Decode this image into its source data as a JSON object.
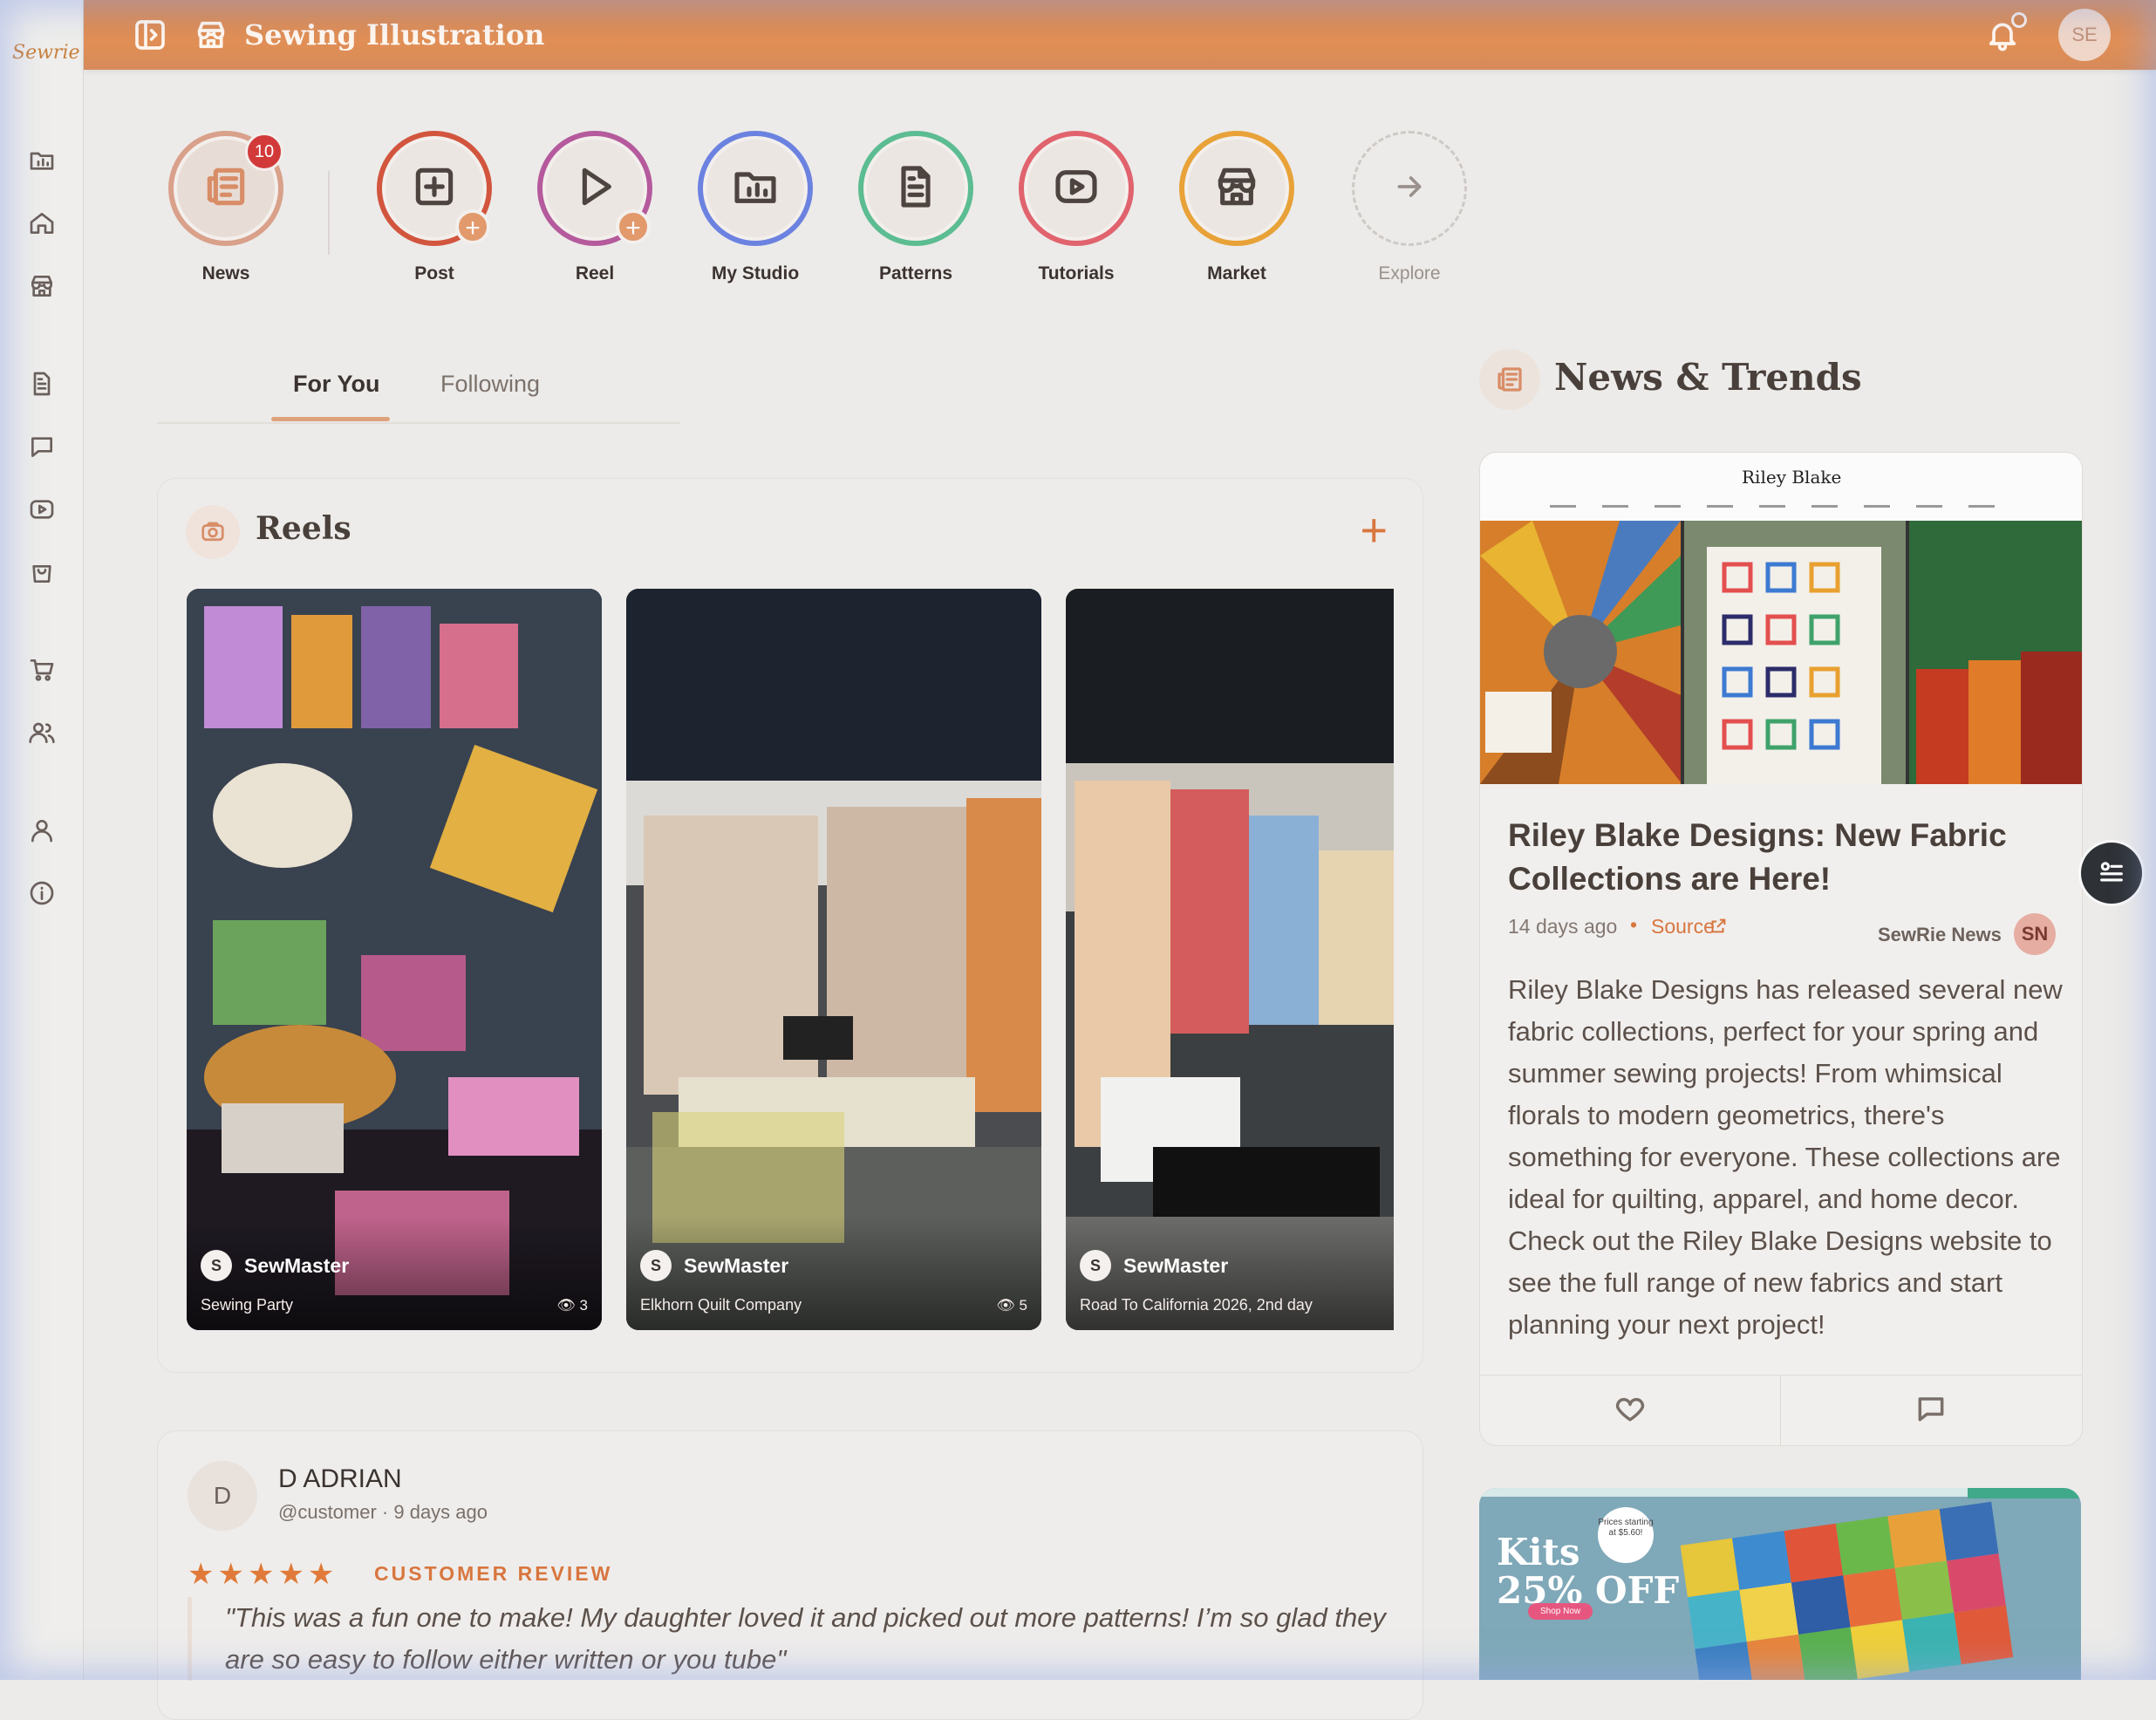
{
  "app": {
    "logo_text": "Sewrie",
    "title": "Sewing Illustration",
    "avatar_initials": "SE"
  },
  "stories": [
    {
      "label": "News",
      "badge": "10",
      "ring": "#d9a08a",
      "icon": "newspaper-icon"
    },
    {
      "label": "Post",
      "ring": "#d2553e",
      "icon": "plus-square-icon"
    },
    {
      "label": "Reel",
      "ring": "#b55a9d",
      "icon": "play-icon"
    },
    {
      "label": "My Studio",
      "ring": "#6c82e0",
      "icon": "folder-chart-icon"
    },
    {
      "label": "Patterns",
      "ring": "#5cbc92",
      "icon": "document-icon"
    },
    {
      "label": "Tutorials",
      "ring": "#e0636e",
      "icon": "video-icon"
    },
    {
      "label": "Market",
      "ring": "#e8a238",
      "icon": "store-icon"
    },
    {
      "label": "Explore",
      "icon": "arrow-right-icon"
    }
  ],
  "tabs": {
    "for_you": "For You",
    "following": "Following"
  },
  "reels": {
    "title": "Reels",
    "items": [
      {
        "avatar": "S",
        "author": "SewMaster",
        "caption": "Sewing Party",
        "views": "3"
      },
      {
        "avatar": "S",
        "author": "SewMaster",
        "caption": "Elkhorn Quilt Company",
        "views": "5"
      },
      {
        "avatar": "S",
        "author": "SewMaster",
        "caption": "Road To California 2026, 2nd day",
        "views": ""
      }
    ]
  },
  "post": {
    "avatar": "D",
    "name": "D ADRIAN",
    "meta": "@customer · 9 days ago",
    "rating": 5,
    "tag": "CUSTOMER REVIEW",
    "quote": "\"This was a fun one to make! My daughter loved it and picked out more patterns!  I’m so glad they are so easy to follow either written or you tube\""
  },
  "news": {
    "section_title": "News & Trends",
    "site_brand": "Riley Blake",
    "headline": "Riley Blake Designs: New Fabric Collections are Here!",
    "date": "14 days ago",
    "source_label": "Source",
    "byline": "SewRie News",
    "byline_initials": "SN",
    "body": "Riley Blake Designs has released several new fabric collections, perfect for your spring and summer sewing projects! From whimsical florals to modern geometrics, there's something for everyone. These collections are ideal for quilting, apparel, and home decor. Check out the Riley Blake Designs website to see the full range of new fabrics and start planning your next project!"
  },
  "promo": {
    "headline_line1": "Kits",
    "headline_line2": "25% OFF",
    "price_note": "Prices starting at $5.60!",
    "cta": "Shop Now"
  },
  "colors": {
    "accent": "#d68247",
    "accent_text": "#d8763f",
    "badge_red": "#d23a3a"
  }
}
